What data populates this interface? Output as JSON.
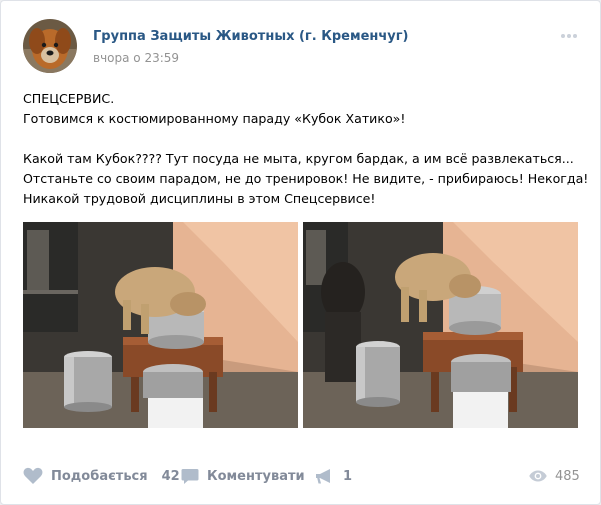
{
  "group": {
    "name": "Группа Защиты Животных (г. Кременчуг)",
    "time": "вчора о 23:59",
    "avatar_icon": "dog-avatar-icon"
  },
  "post": {
    "lines": [
      "СПЕЦСЕРВИС.",
      "Готовимся к костюмированному параду «Кубок Хатико»!",
      "",
      "Какой там Кубок???? Тут посуда не мыта, кругом бардак, а им всё развлекаться...",
      "Отстаньте со своим парадом, не до тренировок! Не видите, - прибираюсь! Некогда!",
      "Никакой трудовой дисциплины в этом Спецсервисе!"
    ]
  },
  "photos": [
    {
      "description_icon": "photo-dog-pots-1"
    },
    {
      "description_icon": "photo-dog-pots-2"
    }
  ],
  "actions": {
    "like_label": "Подобається",
    "like_count": "42",
    "comment_label": "Коментувати",
    "share_count": "1",
    "views_count": "485"
  },
  "colors": {
    "link": "#2a5885",
    "action": "#828a99",
    "muted": "#939393",
    "background": "#edeef0"
  }
}
